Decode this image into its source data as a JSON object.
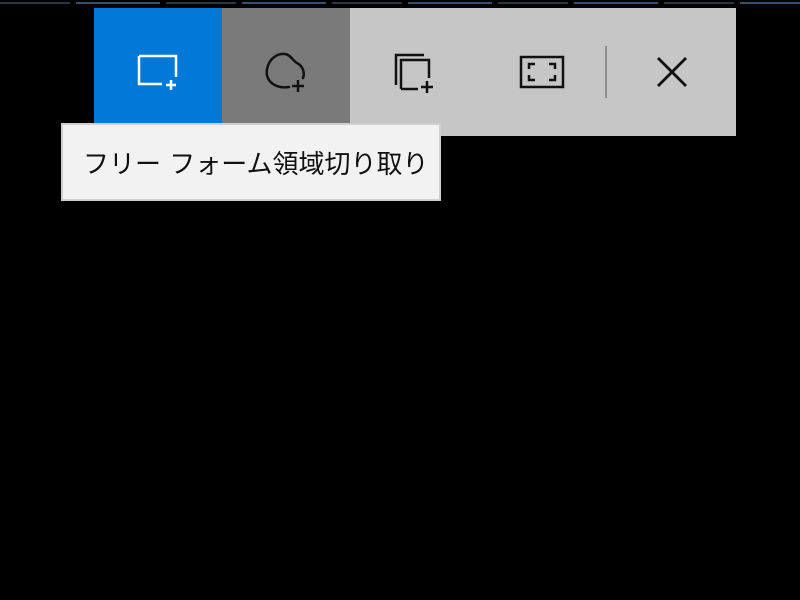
{
  "toolbar": {
    "buttons": [
      {
        "id": "rectangular-snip",
        "icon": "rectangle-plus-icon",
        "state": "selected"
      },
      {
        "id": "freeform-snip",
        "icon": "freeform-plus-icon",
        "state": "hovered"
      },
      {
        "id": "window-snip",
        "icon": "window-plus-icon",
        "state": "normal"
      },
      {
        "id": "fullscreen-snip",
        "icon": "fullscreen-icon",
        "state": "normal"
      },
      {
        "id": "close",
        "icon": "close-icon",
        "state": "normal"
      }
    ]
  },
  "tooltip": {
    "text": "フリー フォーム領域切り取り"
  },
  "colors": {
    "selected": "#0078d7",
    "hovered": "#7a7a7a",
    "toolbar_bg": "#c6c6c6",
    "background": "#000000",
    "tooltip_bg": "#f2f2f2"
  }
}
